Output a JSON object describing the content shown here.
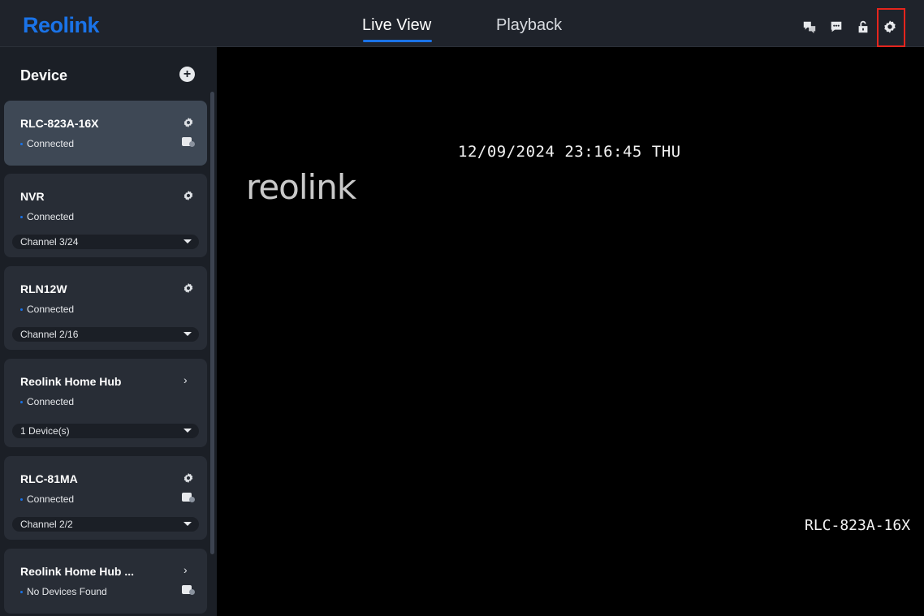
{
  "header": {
    "logo": "Reolink",
    "tabs": [
      {
        "label": "Live View",
        "active": true
      },
      {
        "label": "Playback",
        "active": false
      }
    ],
    "icons": [
      "language-icon",
      "message-icon",
      "unlock-icon",
      "settings-icon"
    ],
    "accent_color": "#1a73e8",
    "highlight_color": "#e5251d"
  },
  "sidebar": {
    "title": "Device",
    "add_icon": "plus-circle-icon",
    "devices": [
      {
        "name": "RLC-823A-16X",
        "status": "Connected",
        "action_icon": "gear-icon",
        "badge": true,
        "dropdown": ""
      },
      {
        "name": "NVR",
        "status": "Connected",
        "action_icon": "gear-icon",
        "badge": false,
        "dropdown": "Channel 3/24"
      },
      {
        "name": "RLN12W",
        "status": "Connected",
        "action_icon": "gear-icon",
        "badge": false,
        "dropdown": "Channel 2/16"
      },
      {
        "name": "Reolink Home Hub",
        "status": "Connected",
        "action_icon": "chevron-right-icon",
        "badge": false,
        "dropdown": "1 Device(s)"
      },
      {
        "name": "RLC-81MA",
        "status": "Connected",
        "action_icon": "gear-icon",
        "badge": true,
        "dropdown": "Channel 2/2"
      },
      {
        "name": "Reolink Home Hub ...",
        "status": "No Devices Found",
        "action_icon": "chevron-right-icon",
        "badge": true,
        "dropdown": ""
      }
    ]
  },
  "video": {
    "timestamp": "12/09/2024 23:16:45 THU",
    "watermark": "reolink",
    "camera_label": "RLC-823A-16X"
  }
}
